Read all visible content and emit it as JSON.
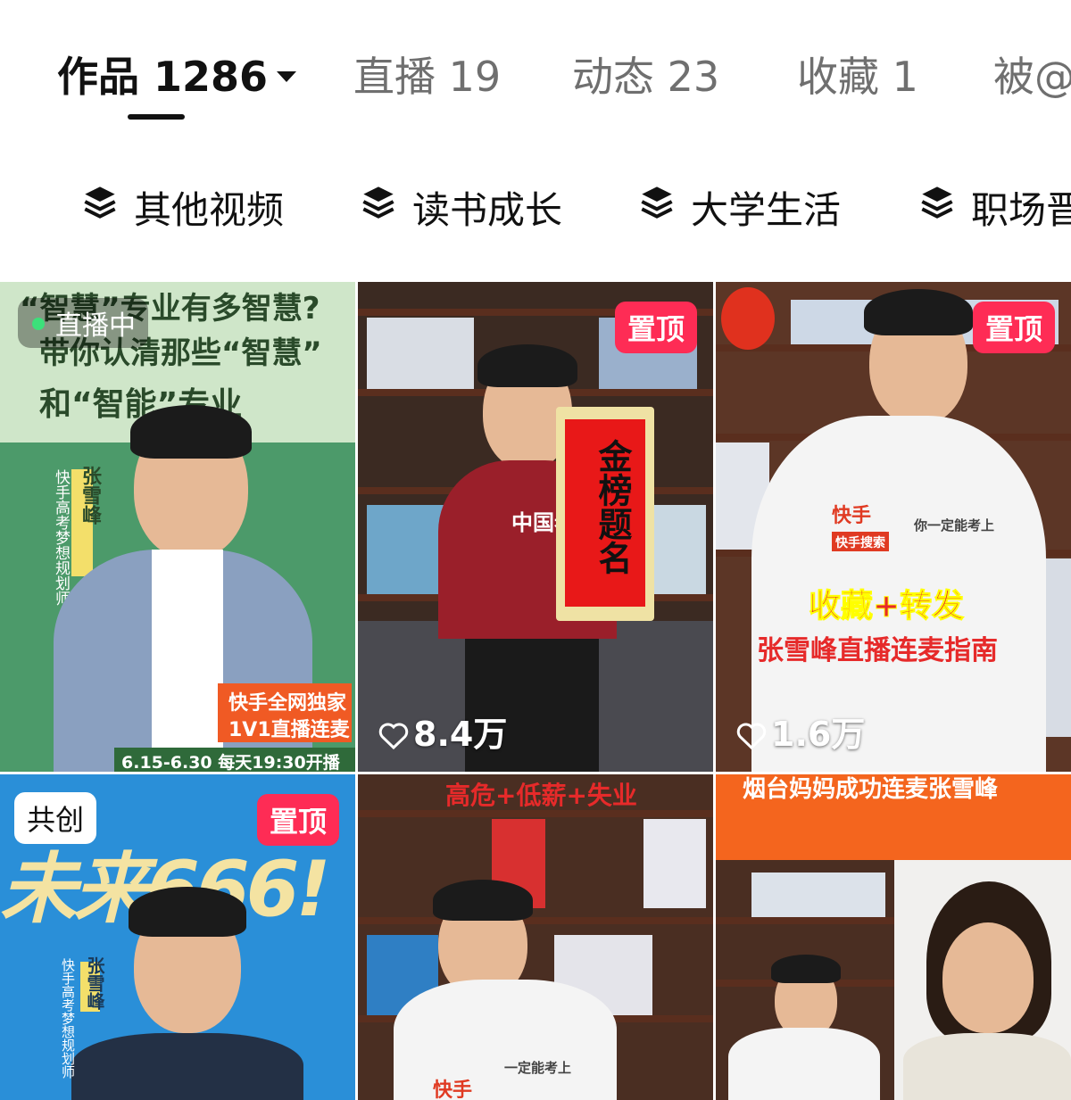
{
  "tabs": [
    {
      "label": "作品 1286",
      "active": true
    },
    {
      "label": "直播 19"
    },
    {
      "label": "动态 23"
    },
    {
      "label": "收藏 1"
    },
    {
      "label": "被@"
    }
  ],
  "collections": [
    {
      "label": "其他视频",
      "icon": "layers-icon"
    },
    {
      "label": "读书成长",
      "icon": "layers-icon"
    },
    {
      "label": "大学生活",
      "icon": "layers-icon"
    },
    {
      "label": "职场晋",
      "icon": "layers-icon"
    }
  ],
  "videos": [
    {
      "live_badge": "直播中",
      "cover_title_1": "“智慧”专业有多智慧?",
      "cover_title_2": "带你认清那些“智慧”",
      "cover_title_3": "和“智能”专业",
      "name": "张雪峰",
      "role": "快手高考梦想规划师",
      "promo_1": "快手全网独家",
      "promo_2": "1V1直播连麦",
      "schedule": "6.15-6.30 每天19:30开播"
    },
    {
      "pinned": "置顶",
      "likes": "8.4万",
      "scroll_text": "金榜题名",
      "shirt_text": "中国老"
    },
    {
      "pinned": "置顶",
      "likes": "1.6万",
      "caption_1": "收藏+转发",
      "caption_2": "张雪峰直播连麦指南",
      "shirt_brand": "快手",
      "shirt_slogan": "你一定能考上",
      "shirt_search": "快手搜索"
    },
    {
      "badge": "共创",
      "pinned": "置顶",
      "cover_big": "未来666!",
      "name": "张雪峰",
      "role": "快手高考梦想规划师"
    },
    {
      "caption": "高危+低薪+失业",
      "shirt_brand": "快手",
      "shirt_slogan": "一定能考上"
    },
    {
      "caption": "烟台妈妈成功连麦张雪峰"
    }
  ]
}
